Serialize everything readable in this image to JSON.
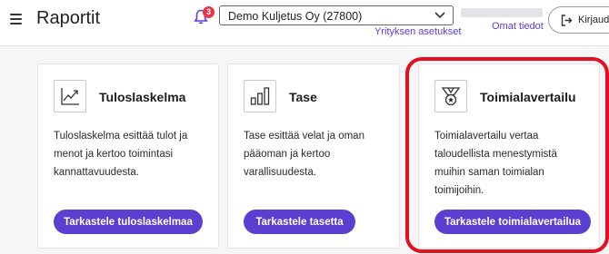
{
  "header": {
    "title": "Raportit",
    "notifications_count": "3",
    "company_select": "Demo Kuljetus Oy (27800)",
    "company_settings_link": "Yrityksen asetukset",
    "own_info_link": "Omat tiedot",
    "logout_label": "Kirjaudu"
  },
  "cards": [
    {
      "title": "Tuloslaskelma",
      "icon": "line-chart-icon",
      "desc": [
        "Tuloslaskelma esittää tulot ja",
        "menot ja kertoo toimintasi",
        "kannattavuudesta."
      ],
      "button": "Tarkastele tuloslaskelmaa"
    },
    {
      "title": "Tase",
      "icon": "bar-chart-icon",
      "desc": [
        "Tase esittää velat ja oman",
        "pääoman ja kertoo",
        "varallisuudesta."
      ],
      "button": "Tarkastele tasetta"
    },
    {
      "title": "Toimialavertailu",
      "icon": "medal-icon",
      "desc": [
        "Toimialavertailu vertaa",
        "taloudellista menestymistä",
        "muihin saman toimialan",
        "toimijoihin."
      ],
      "button": "Tarkastele toimialavertailua"
    }
  ],
  "colors": {
    "accent": "#5a3fd0",
    "link": "#5b3ec8",
    "highlight": "#e40f1f",
    "badge": "#e6354a"
  }
}
